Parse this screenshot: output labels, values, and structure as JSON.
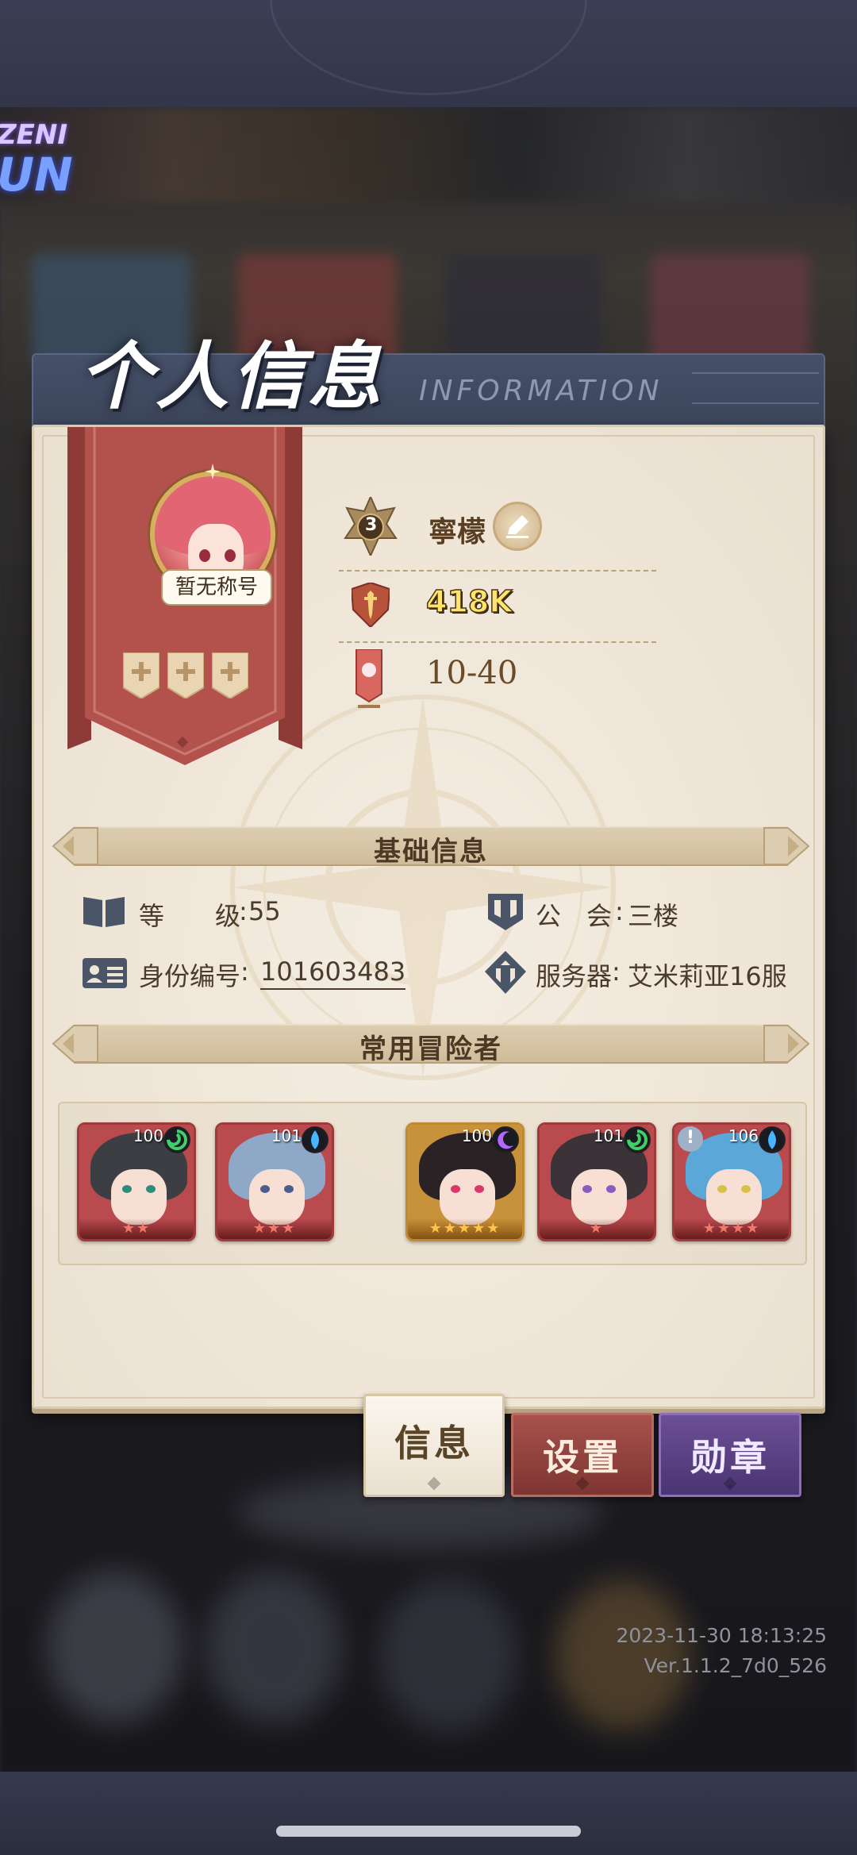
{
  "header": {
    "title": "个人信息",
    "subtitle": "INFORMATION"
  },
  "logo": {
    "line1": "ZENI",
    "line2": "UN"
  },
  "profile": {
    "avatar_title": "暂无称号",
    "rank_level": "3",
    "name": "寧檬",
    "power": "418K",
    "stage": "10-40"
  },
  "basic_info": {
    "section_title": "基础信息",
    "level_label": "等　　级",
    "level_value": "55",
    "guild_label": "公　会",
    "guild_value": "三楼",
    "id_label": "身份编号",
    "id_value": "101603483",
    "server_label": "服务器",
    "server_value": "艾米莉亚16服",
    "separator": ": "
  },
  "adventurers": {
    "section_title": "常用冒险者",
    "heroes": [
      {
        "level": "100",
        "element": "wind",
        "stars": "★★",
        "bg": "#b94a4e",
        "hair": "#3c3e44",
        "eye": "#2f8c7a"
      },
      {
        "level": "101",
        "element": "water",
        "stars": "★★★",
        "bg": "#b94a4e",
        "hair": "#8fa8c8",
        "eye": "#4a5e8c"
      },
      {
        "level": "100",
        "element": "dark",
        "stars": "★★★★★",
        "bg": "#c8923a",
        "hair": "#2b2226",
        "eye": "#d8396a"
      },
      {
        "level": "101",
        "element": "wind",
        "stars": "★",
        "bg": "#b94a4e",
        "hair": "#3b3338",
        "eye": "#8a5cc2"
      },
      {
        "level": "106",
        "element": "water",
        "stars": "★★★★",
        "bg": "#b94a4e",
        "hair": "#5aa7d8",
        "eye": "#d6c24a",
        "warn": "!"
      }
    ]
  },
  "tabs": {
    "info": "信息",
    "settings": "设置",
    "medal": "勋章"
  },
  "footer": {
    "timestamp": "2023-11-30 18:13:25",
    "version": "Ver.1.1.2_7d0_526"
  },
  "colors": {
    "panel": "#efe6d8",
    "banner_red": "#b3524d",
    "power_gold": "#ffe46a",
    "tab_settings": "#8e3f3b",
    "tab_medal": "#5a3f82"
  }
}
